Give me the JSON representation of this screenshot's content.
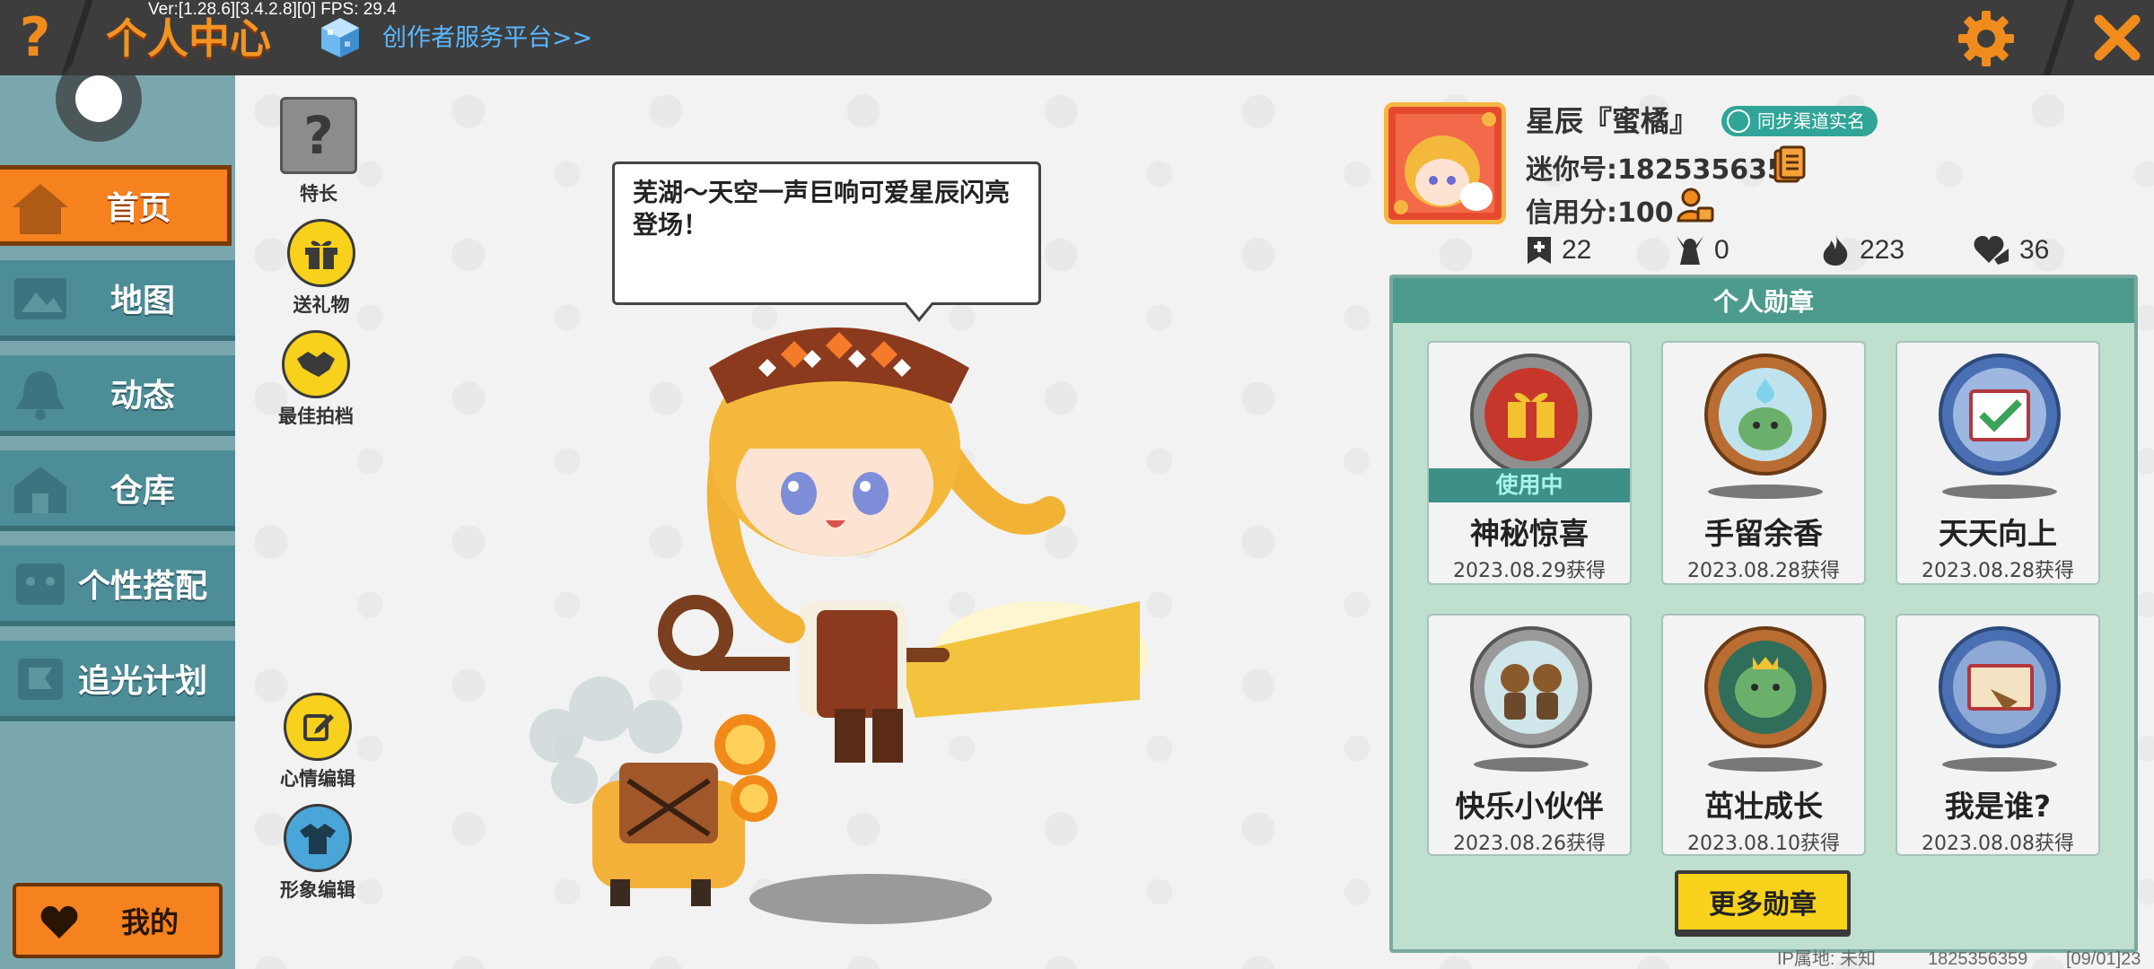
{
  "topbar": {
    "help_glyph": "?",
    "title": "个人中心",
    "version": "Ver:[1.28.6][3.4.2.8][0] FPS: 29.4",
    "creator_link": "创作者服务平台>>",
    "settings_icon": "gear-icon",
    "close_icon": "close-icon"
  },
  "sidebar": {
    "items": [
      {
        "label": "首页",
        "icon": "home-icon",
        "active": true
      },
      {
        "label": "地图",
        "icon": "map-icon",
        "active": false
      },
      {
        "label": "动态",
        "icon": "bell-icon",
        "active": false
      },
      {
        "label": "仓库",
        "icon": "house-icon",
        "active": false
      },
      {
        "label": "个性搭配",
        "icon": "outfit-icon",
        "active": false
      },
      {
        "label": "追光计划",
        "icon": "flag-icon",
        "active": false
      }
    ],
    "mine_label": "我的"
  },
  "actions": {
    "specialty": "特长",
    "gift": "送礼物",
    "partner": "最佳拍档",
    "mood_edit": "心情编辑",
    "avatar_edit": "形象编辑"
  },
  "speech_bubble": "芜湖～天空一声巨响可爱星辰闪亮登场！",
  "profile": {
    "nickname": "星辰『蜜橘』",
    "sync_badge": "同步渠道实名",
    "uid": "迷你号:1825356359",
    "credit": "信用分:100",
    "stats": [
      {
        "icon": "bookmark-plus-icon",
        "value": "22"
      },
      {
        "icon": "person-cheer-icon",
        "value": "0"
      },
      {
        "icon": "flame-icon",
        "value": "223"
      },
      {
        "icon": "heart-hand-icon",
        "value": "36"
      }
    ]
  },
  "medals": {
    "title": "个人勋章",
    "in_use_label": "使用中",
    "items": [
      {
        "name": "神秘惊喜",
        "date": "2023.08.29获得",
        "in_use": true,
        "color": "#d8342a"
      },
      {
        "name": "手留余香",
        "date": "2023.08.28获得",
        "in_use": false,
        "color": "#6bb06a"
      },
      {
        "name": "天天向上",
        "date": "2023.08.28获得",
        "in_use": false,
        "color": "#4a6fb2"
      },
      {
        "name": "快乐小伙伴",
        "date": "2023.08.26获得",
        "in_use": false,
        "color": "#9a9a9a"
      },
      {
        "name": "茁壮成长",
        "date": "2023.08.10获得",
        "in_use": false,
        "color": "#5fa55a"
      },
      {
        "name": "我是谁?",
        "date": "2023.08.08获得",
        "in_use": false,
        "color": "#4a6fb2"
      }
    ],
    "more_label": "更多勋章"
  },
  "footer": {
    "ip_location": "IP属地: 未知",
    "uid_short": "1825356359",
    "date_tag": "[09/01]23"
  },
  "colors": {
    "accent_orange": "#f5821f",
    "teal": "#4c9b8c",
    "nav_blue": "#4d8d98",
    "topbar": "#3d3d3d"
  }
}
